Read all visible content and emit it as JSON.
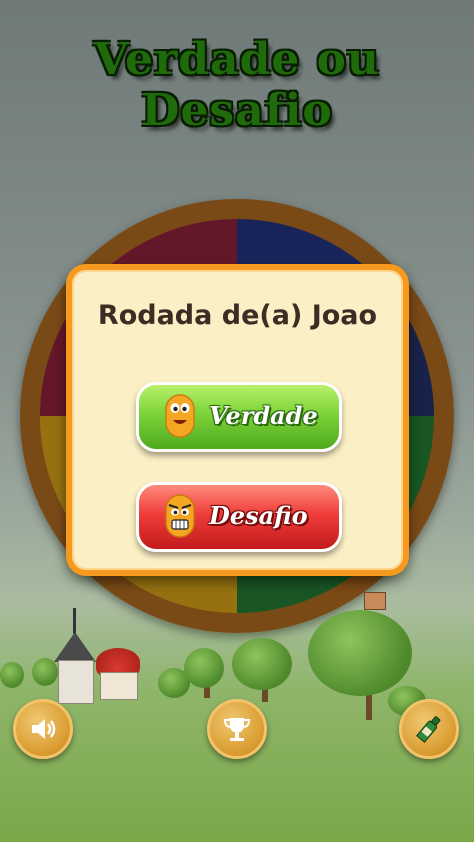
{
  "app": {
    "title": "Verdade ou Desafio"
  },
  "dialog": {
    "title": "Rodada de(a) Joao",
    "truth_label": "Verdade",
    "dare_label": "Desafio"
  },
  "bottom_bar": {
    "sound_icon": "speaker-icon",
    "trophy_icon": "trophy-icon",
    "bottle_icon": "bottle-icon"
  },
  "colors": {
    "dialog_border": "#f59a1e",
    "dialog_background": "#fbefc5",
    "truth_button": "#7dd43a",
    "dare_button": "#ef3e3a",
    "title_text": "#1f6b0c",
    "round_button": "#d99a2f"
  }
}
